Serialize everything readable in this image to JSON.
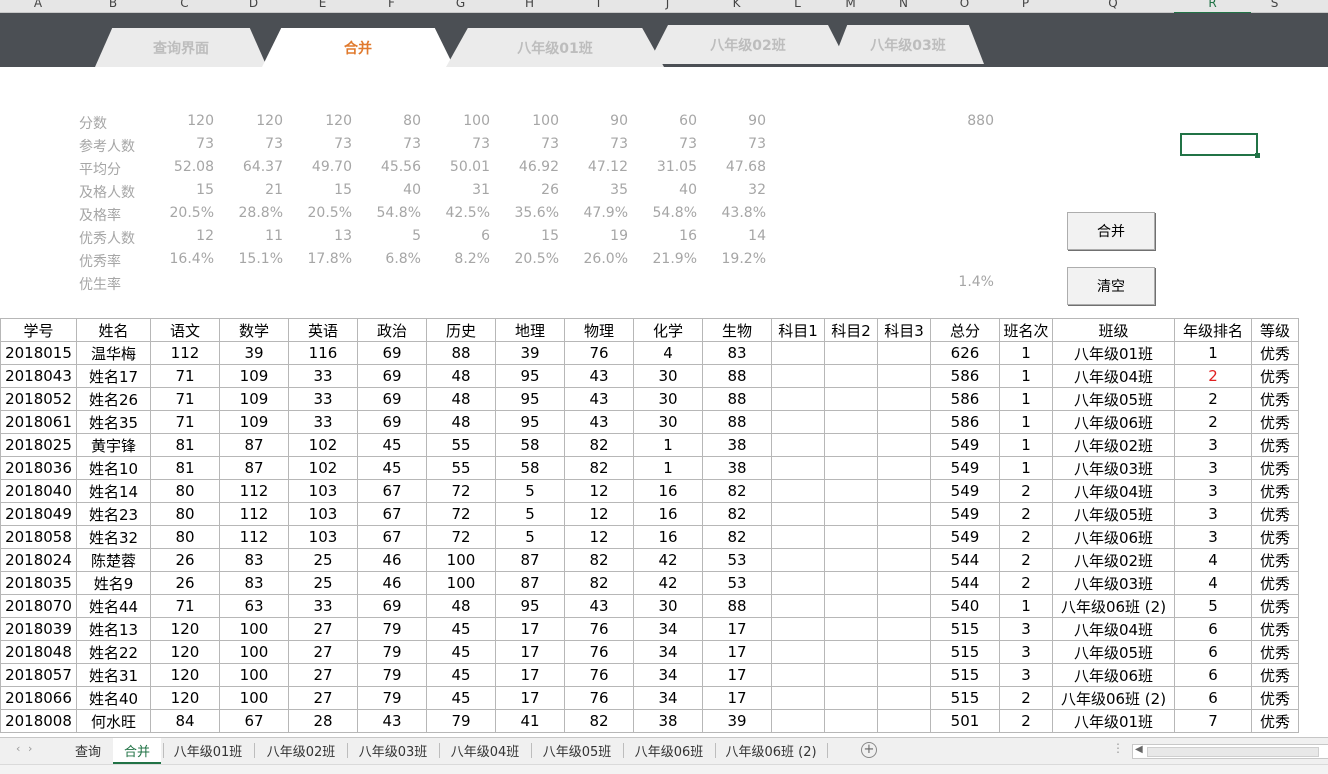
{
  "column_headers": [
    "A",
    "B",
    "C",
    "D",
    "E",
    "F",
    "G",
    "H",
    "I",
    "J",
    "K",
    "L",
    "M",
    "N",
    "O",
    "P",
    "Q",
    "R",
    "S"
  ],
  "selected_column": "R",
  "nav_tabs": [
    {
      "label": "查询界面",
      "active": false
    },
    {
      "label": "合并",
      "active": true
    },
    {
      "label": "八年级01班",
      "active": false
    },
    {
      "label": "八年级02班",
      "active": false
    },
    {
      "label": "八年级03班",
      "active": false
    }
  ],
  "stats": {
    "rows": [
      {
        "label": "分数",
        "values": [
          "120",
          "120",
          "120",
          "80",
          "100",
          "100",
          "90",
          "60",
          "90"
        ],
        "total": "880"
      },
      {
        "label": "参考人数",
        "values": [
          "73",
          "73",
          "73",
          "73",
          "73",
          "73",
          "73",
          "73",
          "73"
        ],
        "total": ""
      },
      {
        "label": "平均分",
        "values": [
          "52.08",
          "64.37",
          "49.70",
          "45.56",
          "50.01",
          "46.92",
          "47.12",
          "31.05",
          "47.68"
        ],
        "total": ""
      },
      {
        "label": "及格人数",
        "values": [
          "15",
          "21",
          "15",
          "40",
          "31",
          "26",
          "35",
          "40",
          "32"
        ],
        "total": ""
      },
      {
        "label": "及格率",
        "values": [
          "20.5%",
          "28.8%",
          "20.5%",
          "54.8%",
          "42.5%",
          "35.6%",
          "47.9%",
          "54.8%",
          "43.8%"
        ],
        "total": ""
      },
      {
        "label": "优秀人数",
        "values": [
          "12",
          "11",
          "13",
          "5",
          "6",
          "15",
          "19",
          "16",
          "14"
        ],
        "total": ""
      },
      {
        "label": "优秀率",
        "values": [
          "16.4%",
          "15.1%",
          "17.8%",
          "6.8%",
          "8.2%",
          "20.5%",
          "26.0%",
          "21.9%",
          "19.2%"
        ],
        "total": ""
      },
      {
        "label": "优生率",
        "values": [
          "",
          "",
          "",
          "",
          "",
          "",
          "",
          "",
          ""
        ],
        "total": "1.4%"
      }
    ]
  },
  "buttons": {
    "merge": "合并",
    "clear": "清空"
  },
  "table": {
    "headers": [
      "学号",
      "姓名",
      "语文",
      "数学",
      "英语",
      "政治",
      "历史",
      "地理",
      "物理",
      "化学",
      "生物",
      "科目1",
      "科目2",
      "科目3",
      "总分",
      "班名次",
      "班级",
      "年级排名",
      "等级"
    ],
    "rows": [
      [
        "2018015",
        "温华梅",
        "112",
        "39",
        "116",
        "69",
        "88",
        "39",
        "76",
        "4",
        "83",
        "",
        "",
        "",
        "626",
        "1",
        "八年级01班",
        "1",
        "优秀"
      ],
      [
        "2018043",
        "姓名17",
        "71",
        "109",
        "33",
        "69",
        "48",
        "95",
        "43",
        "30",
        "88",
        "",
        "",
        "",
        "586",
        "1",
        "八年级04班",
        "2",
        "优秀"
      ],
      [
        "2018052",
        "姓名26",
        "71",
        "109",
        "33",
        "69",
        "48",
        "95",
        "43",
        "30",
        "88",
        "",
        "",
        "",
        "586",
        "1",
        "八年级05班",
        "2",
        "优秀"
      ],
      [
        "2018061",
        "姓名35",
        "71",
        "109",
        "33",
        "69",
        "48",
        "95",
        "43",
        "30",
        "88",
        "",
        "",
        "",
        "586",
        "1",
        "八年级06班",
        "2",
        "优秀"
      ],
      [
        "2018025",
        "黄宇锋",
        "81",
        "87",
        "102",
        "45",
        "55",
        "58",
        "82",
        "1",
        "38",
        "",
        "",
        "",
        "549",
        "1",
        "八年级02班",
        "3",
        "优秀"
      ],
      [
        "2018036",
        "姓名10",
        "81",
        "87",
        "102",
        "45",
        "55",
        "58",
        "82",
        "1",
        "38",
        "",
        "",
        "",
        "549",
        "1",
        "八年级03班",
        "3",
        "优秀"
      ],
      [
        "2018040",
        "姓名14",
        "80",
        "112",
        "103",
        "67",
        "72",
        "5",
        "12",
        "16",
        "82",
        "",
        "",
        "",
        "549",
        "2",
        "八年级04班",
        "3",
        "优秀"
      ],
      [
        "2018049",
        "姓名23",
        "80",
        "112",
        "103",
        "67",
        "72",
        "5",
        "12",
        "16",
        "82",
        "",
        "",
        "",
        "549",
        "2",
        "八年级05班",
        "3",
        "优秀"
      ],
      [
        "2018058",
        "姓名32",
        "80",
        "112",
        "103",
        "67",
        "72",
        "5",
        "12",
        "16",
        "82",
        "",
        "",
        "",
        "549",
        "2",
        "八年级06班",
        "3",
        "优秀"
      ],
      [
        "2018024",
        "陈楚蓉",
        "26",
        "83",
        "25",
        "46",
        "100",
        "87",
        "82",
        "42",
        "53",
        "",
        "",
        "",
        "544",
        "2",
        "八年级02班",
        "4",
        "优秀"
      ],
      [
        "2018035",
        "姓名9",
        "26",
        "83",
        "25",
        "46",
        "100",
        "87",
        "82",
        "42",
        "53",
        "",
        "",
        "",
        "544",
        "2",
        "八年级03班",
        "4",
        "优秀"
      ],
      [
        "2018070",
        "姓名44",
        "71",
        "63",
        "33",
        "69",
        "48",
        "95",
        "43",
        "30",
        "88",
        "",
        "",
        "",
        "540",
        "1",
        "八年级06班 (2)",
        "5",
        "优秀"
      ],
      [
        "2018039",
        "姓名13",
        "120",
        "100",
        "27",
        "79",
        "45",
        "17",
        "76",
        "34",
        "17",
        "",
        "",
        "",
        "515",
        "3",
        "八年级04班",
        "6",
        "优秀"
      ],
      [
        "2018048",
        "姓名22",
        "120",
        "100",
        "27",
        "79",
        "45",
        "17",
        "76",
        "34",
        "17",
        "",
        "",
        "",
        "515",
        "3",
        "八年级05班",
        "6",
        "优秀"
      ],
      [
        "2018057",
        "姓名31",
        "120",
        "100",
        "27",
        "79",
        "45",
        "17",
        "76",
        "34",
        "17",
        "",
        "",
        "",
        "515",
        "3",
        "八年级06班",
        "6",
        "优秀"
      ],
      [
        "2018066",
        "姓名40",
        "120",
        "100",
        "27",
        "79",
        "45",
        "17",
        "76",
        "34",
        "17",
        "",
        "",
        "",
        "515",
        "2",
        "八年级06班 (2)",
        "6",
        "优秀"
      ],
      [
        "2018008",
        "何水旺",
        "84",
        "67",
        "28",
        "43",
        "79",
        "41",
        "82",
        "38",
        "39",
        "",
        "",
        "",
        "501",
        "2",
        "八年级01班",
        "7",
        "优秀"
      ]
    ],
    "highlight_color": "#e02020"
  },
  "sheet_tabs": [
    {
      "label": "查询",
      "active": false
    },
    {
      "label": "合并",
      "active": true
    },
    {
      "label": "八年级01班",
      "active": false
    },
    {
      "label": "八年级02班",
      "active": false
    },
    {
      "label": "八年级03班",
      "active": false
    },
    {
      "label": "八年级04班",
      "active": false
    },
    {
      "label": "八年级05班",
      "active": false
    },
    {
      "label": "八年级06班",
      "active": false
    },
    {
      "label": "八年级06班 (2)",
      "active": false
    }
  ],
  "add_sheet_icon": "plus-circle-icon"
}
